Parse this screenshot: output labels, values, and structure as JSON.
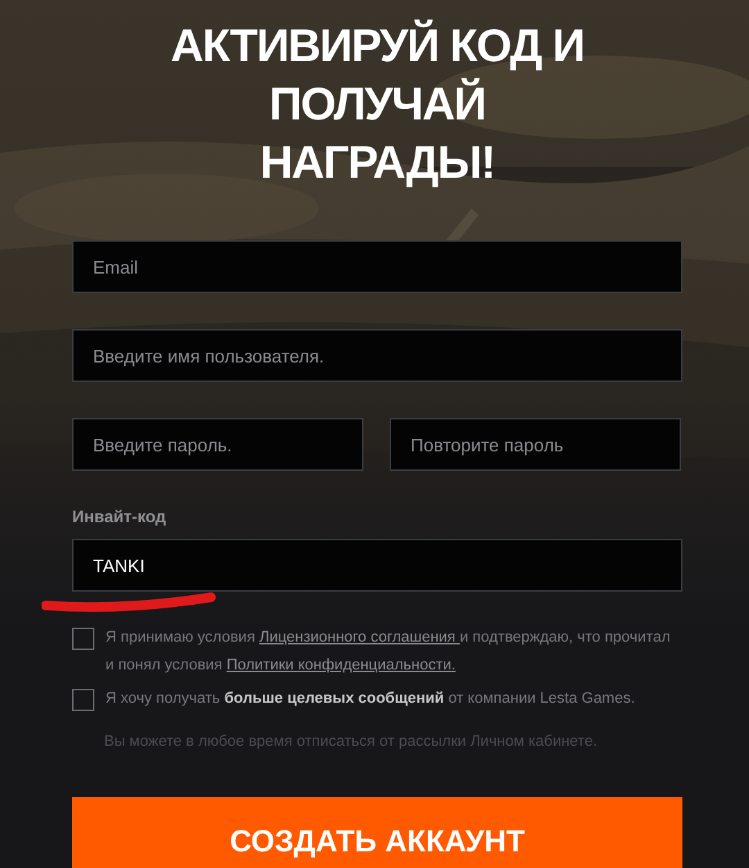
{
  "title_lines": [
    "АКТИВИРУЙ КОД И ПОЛУЧАЙ",
    "НАГРАДЫ!"
  ],
  "fields": [
    {
      "placeholder": "Email"
    },
    {
      "placeholder": "Введите имя пользователя."
    }
  ],
  "password_fields": [
    {
      "placeholder": "Введите пароль."
    },
    {
      "placeholder": "Повторите пароль"
    }
  ],
  "invite": {
    "label": "Инвайт-код",
    "value": "TANKI"
  },
  "agreements": [
    {
      "checked": false,
      "segments": [
        {
          "kind": "text",
          "text": "Я принимаю условия "
        },
        {
          "kind": "link",
          "text": "Лицензионного соглашения "
        },
        {
          "kind": "text",
          "text": "и подтверждаю, что прочитал и понял условия "
        },
        {
          "kind": "link",
          "text": "Политики конфиденциальности."
        }
      ]
    },
    {
      "checked": false,
      "segments": [
        {
          "kind": "text",
          "text": "Я хочу получать "
        },
        {
          "kind": "bold",
          "text": "больше целевых сообщений"
        },
        {
          "kind": "text",
          "text": " от компании Lesta Games."
        }
      ]
    }
  ],
  "note": "Вы можете в любое время отписаться от рассылки Личном кабинете.",
  "submit": "СОЗДАТЬ АККАУНТ"
}
